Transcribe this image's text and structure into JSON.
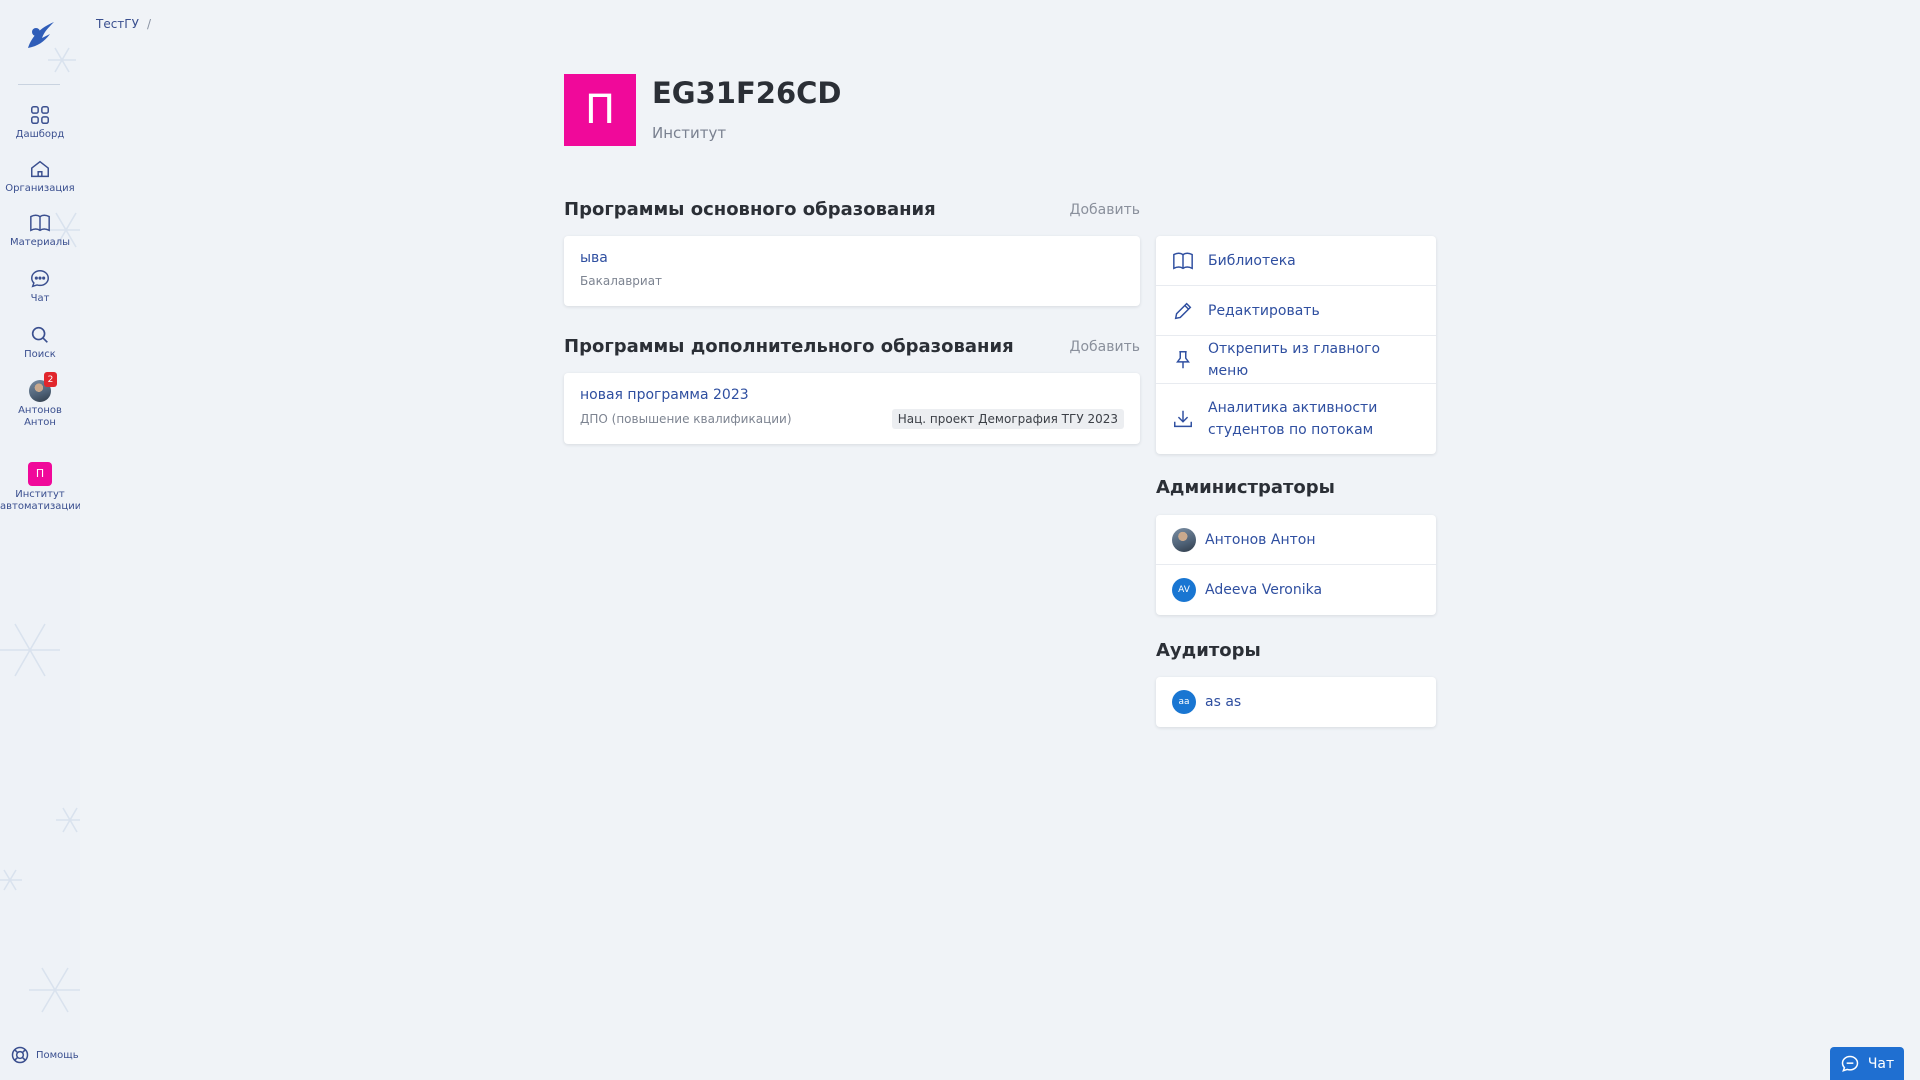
{
  "sidebar": {
    "items": [
      {
        "label": "Дашборд",
        "icon": "dashboard-icon"
      },
      {
        "label": "Организация",
        "icon": "home-icon"
      },
      {
        "label": "Материалы",
        "icon": "book-icon"
      },
      {
        "label": "Чат",
        "icon": "chat-icon"
      },
      {
        "label": "Поиск",
        "icon": "search-icon"
      }
    ],
    "user": {
      "name": "Антонов Антон",
      "badge": "2"
    },
    "org": {
      "initial": "П",
      "name": "Институт автоматизации"
    },
    "help_label": "Помощь"
  },
  "breadcrumb": {
    "root": "ТестГУ",
    "separator": "/"
  },
  "header": {
    "logo_letter": "П",
    "title": "EG31F26CD",
    "subtitle": "Институт",
    "logo_color": "#f0099a"
  },
  "main_programs": {
    "title": "Программы основного образования",
    "add_label": "Добавить",
    "items": [
      {
        "title": "ыва",
        "subtitle": "Бакалавриат"
      }
    ]
  },
  "extra_programs": {
    "title": "Программы дополнительного образования",
    "add_label": "Добавить",
    "items": [
      {
        "title": "новая программа 2023",
        "subtitle": "ДПО (повышение квалификации)",
        "tag": "Нац. проект Демография ТГУ 2023"
      }
    ]
  },
  "actions": [
    {
      "label": "Библиотека",
      "icon": "book-icon"
    },
    {
      "label": "Редактировать",
      "icon": "pencil-icon"
    },
    {
      "label": "Открепить из главного меню",
      "icon": "pin-icon"
    },
    {
      "label": "Аналитика активности студентов по потокам",
      "icon": "download-icon"
    }
  ],
  "admins": {
    "title": "Администраторы",
    "items": [
      {
        "name": "Антонов Антон",
        "initials": ""
      },
      {
        "name": "Adeeva Veronika",
        "initials": "AV"
      }
    ]
  },
  "auditors": {
    "title": "Аудиторы",
    "items": [
      {
        "name": "as as",
        "initials": "aa"
      }
    ]
  },
  "chat_button": {
    "label": "Чат"
  },
  "colors": {
    "accent": "#2f4fa0",
    "brand": "#f0099a",
    "chat": "#1f6fd1",
    "badge": "#e1262c"
  }
}
